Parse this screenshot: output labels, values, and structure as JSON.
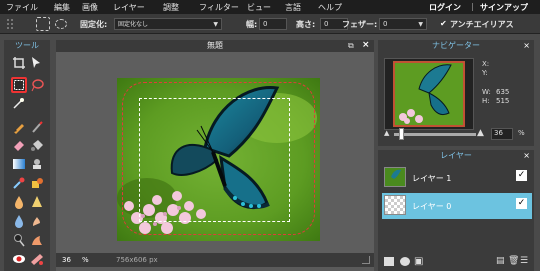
{
  "menu": {
    "items": [
      "ファイル",
      "編集",
      "画像",
      "レイヤー",
      "調整",
      "フィルター",
      "ビュー",
      "言語",
      "ヘルプ"
    ],
    "login": "ログイン",
    "separator": "|",
    "signup": "サインアップ"
  },
  "options": {
    "fixed_label": "固定化:",
    "fixed_value": "固定化なし",
    "width_label": "幅:",
    "width_value": "0",
    "height_label": "高さ:",
    "height_value": "0",
    "feather_label": "フェザー:",
    "feather_value": "0",
    "antialias_label": "アンチエイリアス"
  },
  "tools": {
    "title": "ツール"
  },
  "document": {
    "title": "無題",
    "zoom": "36",
    "zoom_unit": "%",
    "size": "756x606 px"
  },
  "navigator": {
    "title": "ナビゲーター",
    "x_label": "X:",
    "y_label": "Y:",
    "w_label": "W:",
    "w_value": "635",
    "h_label": "H:",
    "h_value": "515",
    "zoom_value": "36",
    "zoom_unit": "%"
  },
  "layers": {
    "title": "レイヤー",
    "items": [
      {
        "name": "レイヤー 1",
        "checked": true
      },
      {
        "name": "レイヤー 0",
        "checked": true
      }
    ]
  },
  "colors": {
    "accent": "#7fc2e6",
    "selected_layer": "#6cc3e0",
    "selection_red": "#e23a3a"
  }
}
